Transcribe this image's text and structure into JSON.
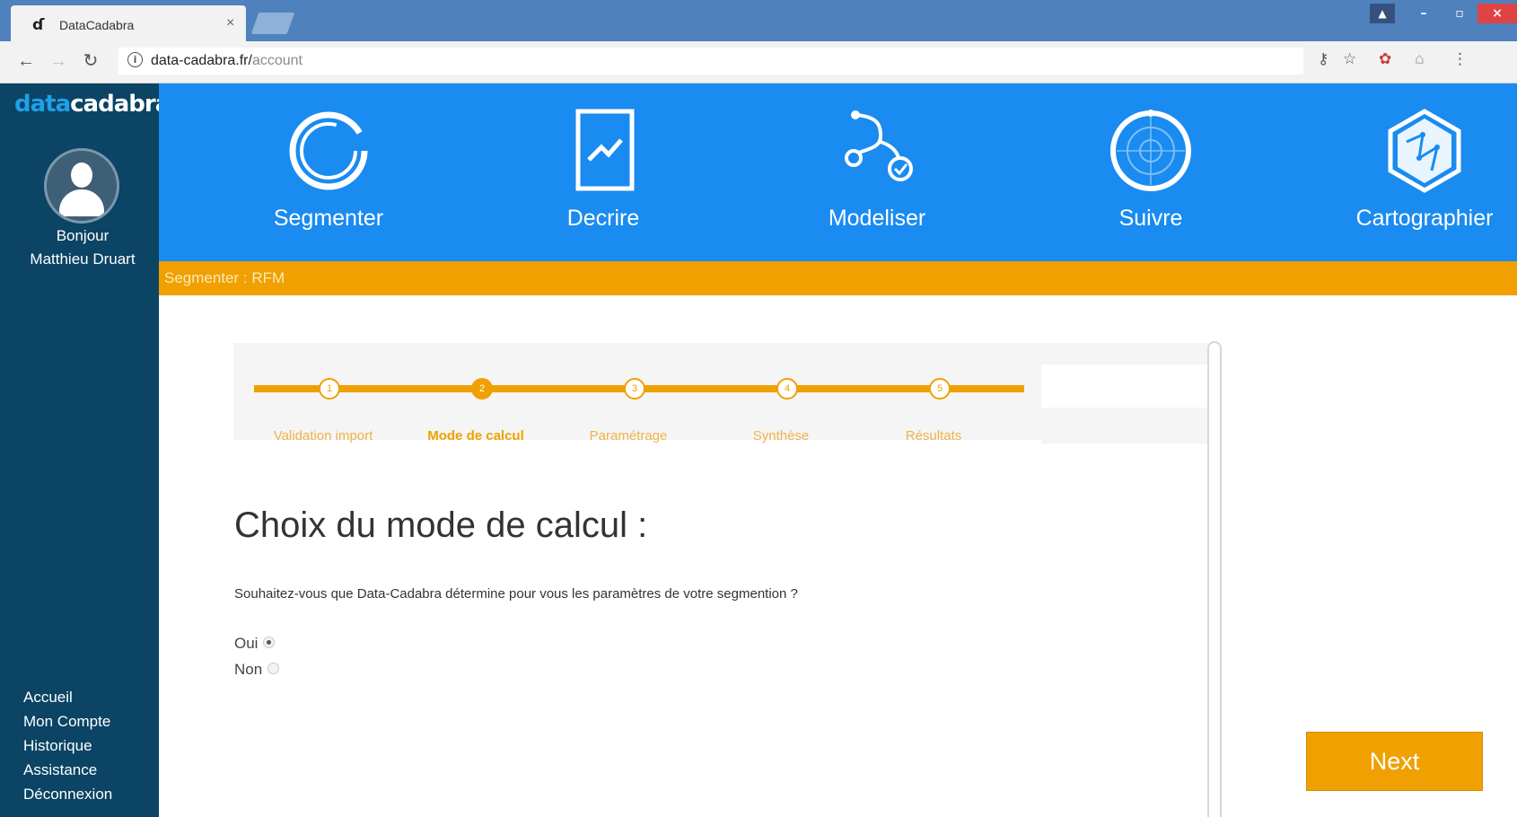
{
  "browser": {
    "tab_title": "DataCadabra",
    "tab_close": "×",
    "url_host": "data-cadabra.fr/",
    "url_path": "account"
  },
  "sidebar": {
    "logo_part1": "data",
    "logo_part2": "cadabra",
    "greeting": "Bonjour",
    "user_name": "Matthieu Druart",
    "links": [
      "Accueil",
      "Mon Compte",
      "Historique",
      "Assistance",
      "Déconnexion"
    ]
  },
  "topnav": {
    "items": [
      "Segmenter",
      "Decrire",
      "Modeliser",
      "Suivre",
      "Cartographier"
    ]
  },
  "breadcrumb": "Segmenter : RFM",
  "stepper": {
    "steps": [
      {
        "num": "1",
        "label": "Validation import"
      },
      {
        "num": "2",
        "label": "Mode de calcul"
      },
      {
        "num": "3",
        "label": "Paramétrage"
      },
      {
        "num": "4",
        "label": "Synthèse"
      },
      {
        "num": "5",
        "label": "Résultats"
      }
    ],
    "active_step": 2
  },
  "main": {
    "title": "Choix du mode de calcul :",
    "question": "Souhaitez-vous que Data-Cadabra détermine pour vous les paramètres de votre segmention ?",
    "option_yes": "Oui",
    "option_no": "Non",
    "selected": "Oui",
    "next_label": "Next"
  },
  "colors": {
    "sidebar": "#0b4464",
    "topnav": "#1a8bf0",
    "accent": "#f0a000"
  }
}
